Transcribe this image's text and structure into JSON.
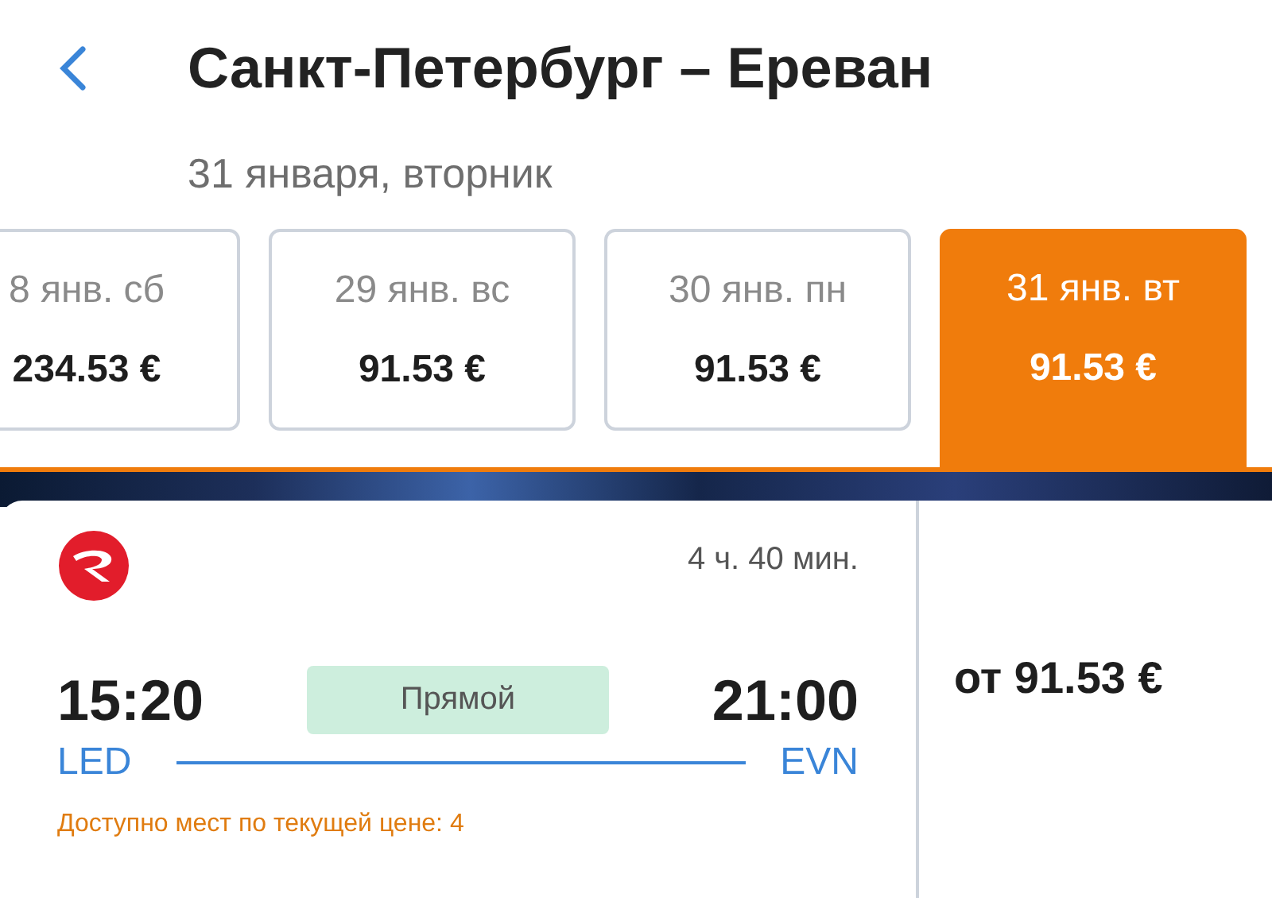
{
  "header": {
    "title": "Санкт-Петербург – Ереван",
    "subtitle": "31 января, вторник"
  },
  "dates": [
    {
      "date": "8 янв. сб",
      "price": "234.53 €",
      "selected": false
    },
    {
      "date": "29 янв. вс",
      "price": "91.53 €",
      "selected": false
    },
    {
      "date": "30 янв. пн",
      "price": "91.53 €",
      "selected": false
    },
    {
      "date": "31 янв. вт",
      "price": "91.53 €",
      "selected": true
    }
  ],
  "flight": {
    "duration": "4 ч. 40 мин.",
    "depart_time": "15:20",
    "arrive_time": "21:00",
    "type": "Прямой",
    "from": "LED",
    "to": "EVN",
    "seats_note": "Доступно мест по текущей цене: 4",
    "price": "от 91.53 €"
  }
}
